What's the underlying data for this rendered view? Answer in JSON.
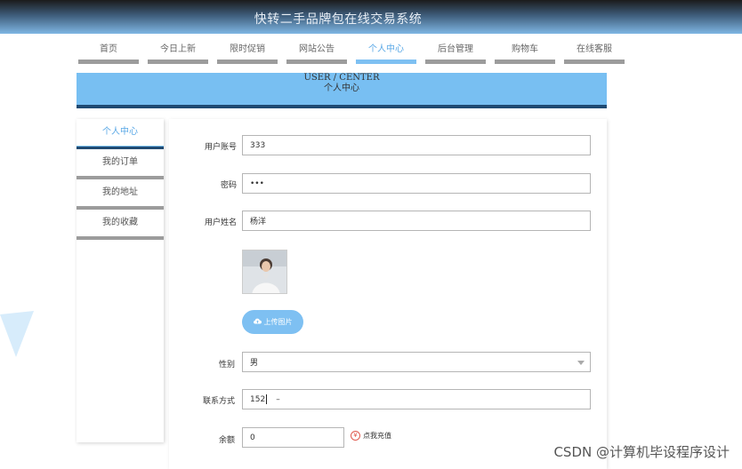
{
  "app": {
    "title": "快转二手品牌包在线交易系统"
  },
  "nav": {
    "items": [
      {
        "label": "首页",
        "active": false
      },
      {
        "label": "今日上新",
        "active": false
      },
      {
        "label": "限时促销",
        "active": false
      },
      {
        "label": "网站公告",
        "active": false
      },
      {
        "label": "个人中心",
        "active": true
      },
      {
        "label": "后台管理",
        "active": false
      },
      {
        "label": "购物车",
        "active": false
      },
      {
        "label": "在线客服",
        "active": false
      }
    ]
  },
  "banner": {
    "en": "USER / CENTER",
    "cn": "个人中心"
  },
  "sidebar": {
    "items": [
      {
        "label": "个人中心",
        "active": true
      },
      {
        "label": "我的订单",
        "active": false
      },
      {
        "label": "我的地址",
        "active": false
      },
      {
        "label": "我的收藏",
        "active": false
      }
    ]
  },
  "form": {
    "account": {
      "label": "用户账号",
      "value": "333"
    },
    "password": {
      "label": "密码",
      "value": "•••"
    },
    "name": {
      "label": "用户姓名",
      "value": "杨洋"
    },
    "upload_label": "上传图片",
    "gender": {
      "label": "性别",
      "value": "男"
    },
    "contact": {
      "label": "联系方式",
      "value": "152",
      "suffix": "–"
    },
    "balance": {
      "label": "余额",
      "value": "0"
    },
    "recharge_label": "点我充值",
    "recharge_icon_glyph": "¥"
  },
  "watermark": "CSDN @计算机毕设程序设计",
  "colors": {
    "accent": "#7ec0f2",
    "dark_blue": "#1f4a72",
    "nav_bar": "#9c9c9c"
  }
}
